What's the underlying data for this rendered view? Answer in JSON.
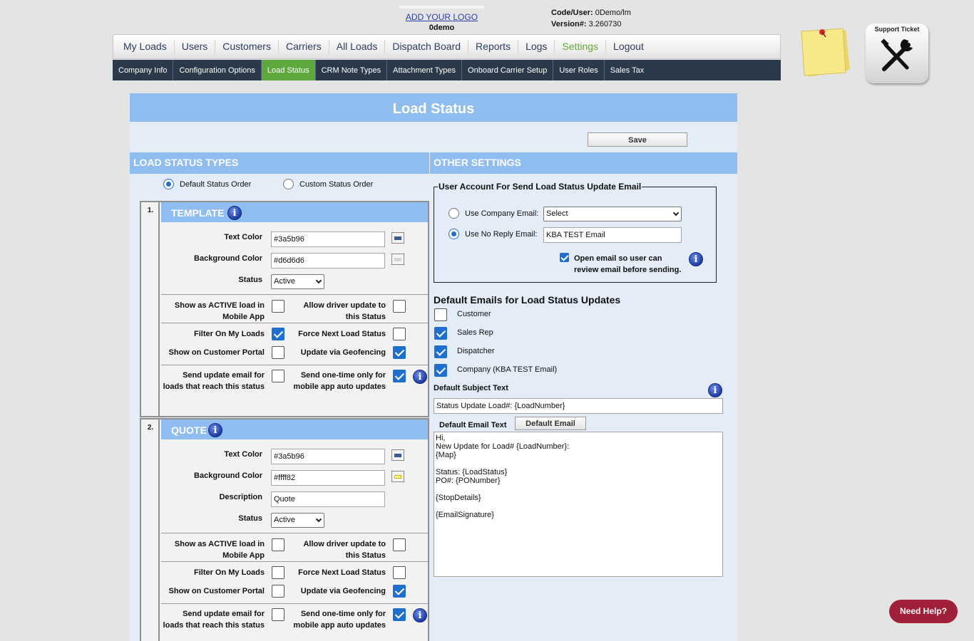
{
  "header": {
    "logo_link": "ADD YOUR LOGO",
    "company": "0demo",
    "code_user_label": "Code/User:",
    "code_user_value": "0Demo/lm",
    "version_label": "Version#:",
    "version_value": "3.260730"
  },
  "main_nav": [
    "My Loads",
    "Users",
    "Customers",
    "Carriers",
    "All Loads",
    "Dispatch Board",
    "Reports",
    "Logs",
    "Settings",
    "Logout"
  ],
  "main_nav_active": "Settings",
  "sub_nav": [
    "Company Info",
    "Configuration Options",
    "Load Status",
    "CRM Note Types",
    "Attachment Types",
    "Onboard Carrier Setup",
    "User Roles",
    "Sales Tax"
  ],
  "sub_nav_active": "Load Status",
  "support_ticket": "Support Ticket",
  "page_title": "Load Status",
  "save_label": "Save",
  "left_section": "LOAD STATUS TYPES",
  "right_section": "OTHER SETTINGS",
  "order": {
    "default_label": "Default Status Order",
    "custom_label": "Custom Status Order",
    "selected": "default"
  },
  "labels": {
    "text_color": "Text Color",
    "background_color": "Background Color",
    "description": "Description",
    "status": "Status",
    "show_active_1": "Show as ACTIVE load in",
    "show_active_2": "Mobile App",
    "allow_driver_1": "Allow driver update to",
    "allow_driver_2": "this Status",
    "filter_my_loads": "Filter On My Loads",
    "force_next": "Force Next Load Status",
    "show_portal": "Show on Customer Portal",
    "geofencing": "Update via Geofencing",
    "send_update_1": "Send update email for",
    "send_update_2": "loads that reach this status",
    "send_onetime_1": "Send one-time only for",
    "send_onetime_2": "mobile app auto updates"
  },
  "statuses": [
    {
      "number": "1.",
      "name": "TEMPLATE",
      "text_color": "#3a5b96",
      "background_color": "#d6d6d6",
      "status": "Active",
      "show_active": false,
      "allow_driver": false,
      "filter_my_loads": true,
      "force_next": false,
      "show_portal": false,
      "geofencing": true,
      "send_update": false,
      "send_onetime": true
    },
    {
      "number": "2.",
      "name": "QUOTE",
      "text_color": "#3a5b96",
      "background_color": "#ffff82",
      "description": "Quote",
      "status": "Active",
      "show_active": false,
      "allow_driver": false,
      "filter_my_loads": false,
      "force_next": false,
      "show_portal": false,
      "geofencing": true,
      "send_update": false,
      "send_onetime": true
    }
  ],
  "email_account": {
    "legend": "User Account For Send Load Status Update Email",
    "company_email_label": "Use Company Email:",
    "company_email_select": "Select",
    "no_reply_label": "Use No Reply Email:",
    "no_reply_value": "KBA TEST Email",
    "selected": "no_reply",
    "open_email_1": "Open email so user can",
    "open_email_2": "review email before sending.",
    "open_email_checked": true
  },
  "default_emails": {
    "title": "Default Emails for Load Status Updates",
    "recipients": [
      {
        "label": "Customer",
        "checked": false
      },
      {
        "label": "Sales Rep",
        "checked": true
      },
      {
        "label": "Dispatcher",
        "checked": true
      },
      {
        "label": "Company (KBA TEST Email)",
        "checked": true
      }
    ],
    "subject_label": "Default Subject Text",
    "subject_value": "Status Update Load#: {LoadNumber}",
    "email_text_label": "Default Email Text",
    "default_email_button": "Default Email",
    "email_body": "Hi,\nNew Update for Load# {LoadNumber}:\n{Map}\n\nStatus: {LoadStatus}\nPO#: {PONumber}\n\n{StopDetails}\n\n{EmailSignature}"
  },
  "need_help": "Need Help?",
  "colors": {
    "accent": "#8fbdf0",
    "active_green": "#5ea83c",
    "subnav_bg": "#2a3a4a",
    "need_help": "#a0203a",
    "checkbox": "#1f6fcf"
  }
}
